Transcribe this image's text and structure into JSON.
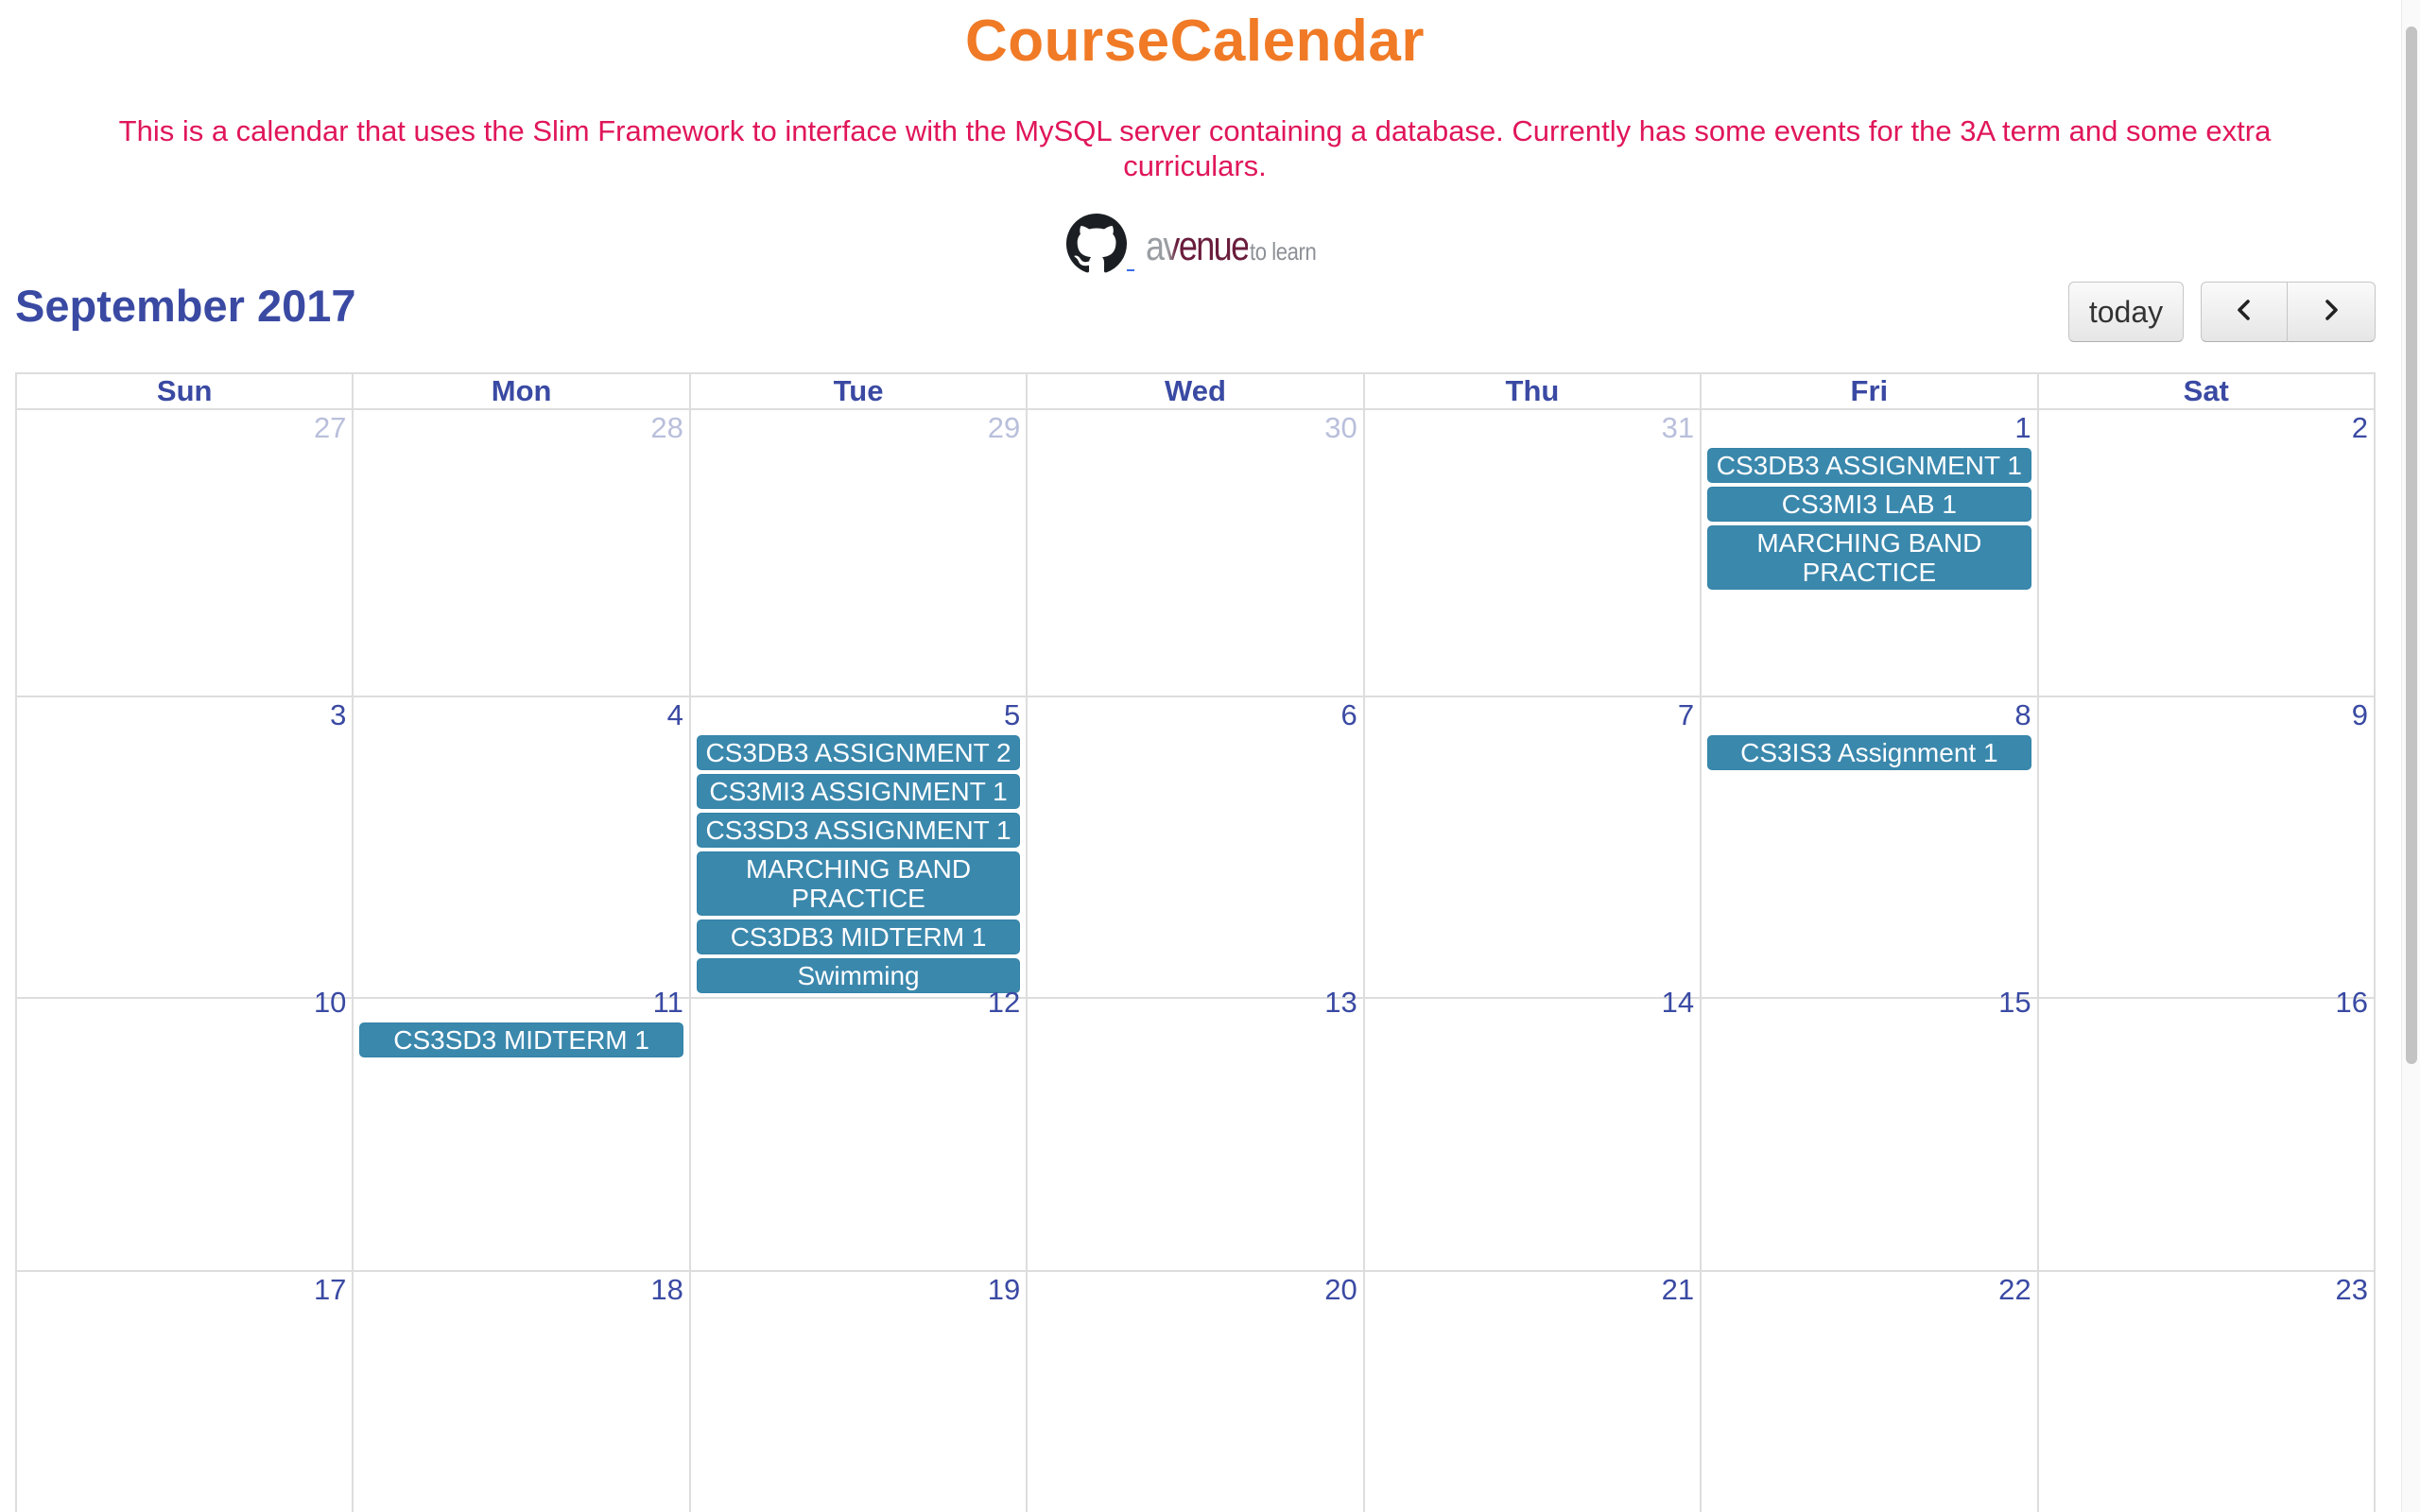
{
  "app": {
    "title": "CourseCalendar",
    "description": "This is a calendar that uses the Slim Framework to interface with the MySQL server containing a database. Currently has some events for the 3A term and some extra curriculars."
  },
  "links": {
    "github_icon": "github-icon",
    "avenue_logo": {
      "word": "avenue",
      "suffix": "to learn"
    }
  },
  "toolbar": {
    "month_title": "September 2017",
    "today_label": "today",
    "prev_icon": "chevron-left-icon",
    "next_icon": "chevron-right-icon"
  },
  "colors": {
    "title": "#f07a26",
    "description": "#e0165a",
    "header_text": "#3a4aa3",
    "event_bg": "#3b88ad",
    "other_month_text": "#b9bfdb"
  },
  "calendar": {
    "weekdays": [
      "Sun",
      "Mon",
      "Tue",
      "Wed",
      "Thu",
      "Fri",
      "Sat"
    ],
    "weeks": [
      [
        {
          "day": "27",
          "other": true,
          "events": []
        },
        {
          "day": "28",
          "other": true,
          "events": []
        },
        {
          "day": "29",
          "other": true,
          "events": []
        },
        {
          "day": "30",
          "other": true,
          "events": []
        },
        {
          "day": "31",
          "other": true,
          "events": []
        },
        {
          "day": "1",
          "other": false,
          "events": [
            "CS3DB3 ASSIGNMENT 1",
            "CS3MI3 LAB 1",
            "MARCHING BAND PRACTICE"
          ]
        },
        {
          "day": "2",
          "other": false,
          "events": []
        }
      ],
      [
        {
          "day": "3",
          "other": false,
          "events": []
        },
        {
          "day": "4",
          "other": false,
          "events": []
        },
        {
          "day": "5",
          "other": false,
          "events": [
            "CS3DB3 ASSIGNMENT 2",
            "CS3MI3 ASSIGNMENT 1",
            "CS3SD3 ASSIGNMENT 1",
            "MARCHING BAND PRACTICE",
            "CS3DB3 MIDTERM 1",
            "Swimming"
          ]
        },
        {
          "day": "6",
          "other": false,
          "events": []
        },
        {
          "day": "7",
          "other": false,
          "events": []
        },
        {
          "day": "8",
          "other": false,
          "events": [
            "CS3IS3 Assignment 1"
          ]
        },
        {
          "day": "9",
          "other": false,
          "events": []
        }
      ],
      [
        {
          "day": "10",
          "other": false,
          "events": []
        },
        {
          "day": "11",
          "other": false,
          "events": [
            "CS3SD3 MIDTERM 1"
          ]
        },
        {
          "day": "12",
          "other": false,
          "events": []
        },
        {
          "day": "13",
          "other": false,
          "events": []
        },
        {
          "day": "14",
          "other": false,
          "events": []
        },
        {
          "day": "15",
          "other": false,
          "events": []
        },
        {
          "day": "16",
          "other": false,
          "events": []
        }
      ],
      [
        {
          "day": "17",
          "other": false,
          "events": []
        },
        {
          "day": "18",
          "other": false,
          "events": []
        },
        {
          "day": "19",
          "other": false,
          "events": []
        },
        {
          "day": "20",
          "other": false,
          "events": []
        },
        {
          "day": "21",
          "other": false,
          "events": []
        },
        {
          "day": "22",
          "other": false,
          "events": []
        },
        {
          "day": "23",
          "other": false,
          "events": []
        }
      ]
    ]
  }
}
